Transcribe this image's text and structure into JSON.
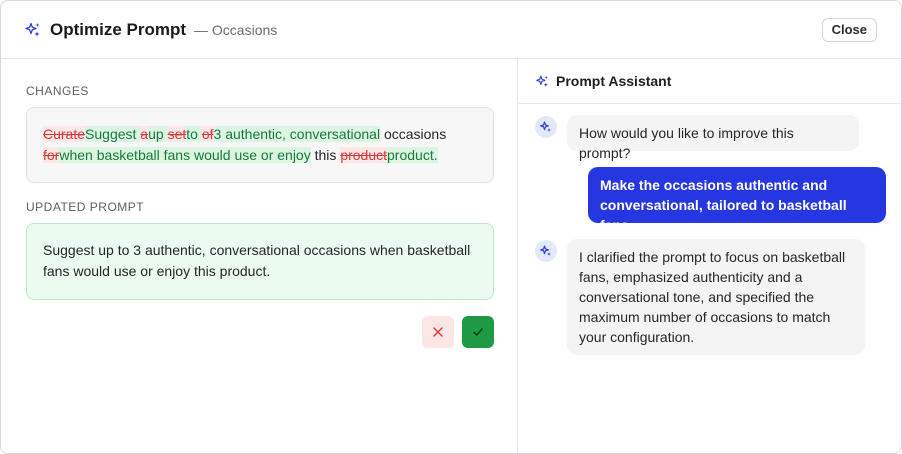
{
  "header": {
    "title": "Optimize Prompt",
    "subtitle": "— Occasions",
    "close_label": "Close"
  },
  "changes": {
    "label": "CHANGES",
    "segments": [
      {
        "type": "del",
        "text": "Curate"
      },
      {
        "type": "ins",
        "text": "Suggest "
      },
      {
        "type": "del",
        "text": "a"
      },
      {
        "type": "ins",
        "text": "up "
      },
      {
        "type": "del",
        "text": "set"
      },
      {
        "type": "ins",
        "text": "to "
      },
      {
        "type": "del",
        "text": "of"
      },
      {
        "type": "ins",
        "text": "3 authentic, conversational"
      },
      {
        "type": "same",
        "text": " occasions "
      },
      {
        "type": "del",
        "text": "for"
      },
      {
        "type": "ins",
        "text": "when basketball fans would use or enjoy"
      },
      {
        "type": "same",
        "text": " this "
      },
      {
        "type": "del",
        "text": "product"
      },
      {
        "type": "ins",
        "text": "product."
      }
    ]
  },
  "updated": {
    "label": "UPDATED PROMPT",
    "text": "Suggest up to 3 authentic, conversational occasions when basketball fans would use or enjoy this product."
  },
  "actions": {
    "reject_icon": "x-icon",
    "accept_icon": "check-icon"
  },
  "assistant": {
    "title": "Prompt Assistant",
    "messages": [
      {
        "role": "assistant",
        "text": "How would you like to improve this prompt?"
      },
      {
        "role": "user",
        "text": "Make the occasions authentic and conversational, tailored to basketball fans"
      },
      {
        "role": "assistant",
        "text": "I clarified the prompt to focus on basketball fans, emphasized authenticity and a conversational tone, and specified the maximum number of occasions to match your configuration."
      }
    ]
  },
  "colors": {
    "accent": "#2537e0",
    "insert_text": "#177a3c",
    "delete_text": "#d23b3b",
    "accept": "#1e9a43"
  }
}
